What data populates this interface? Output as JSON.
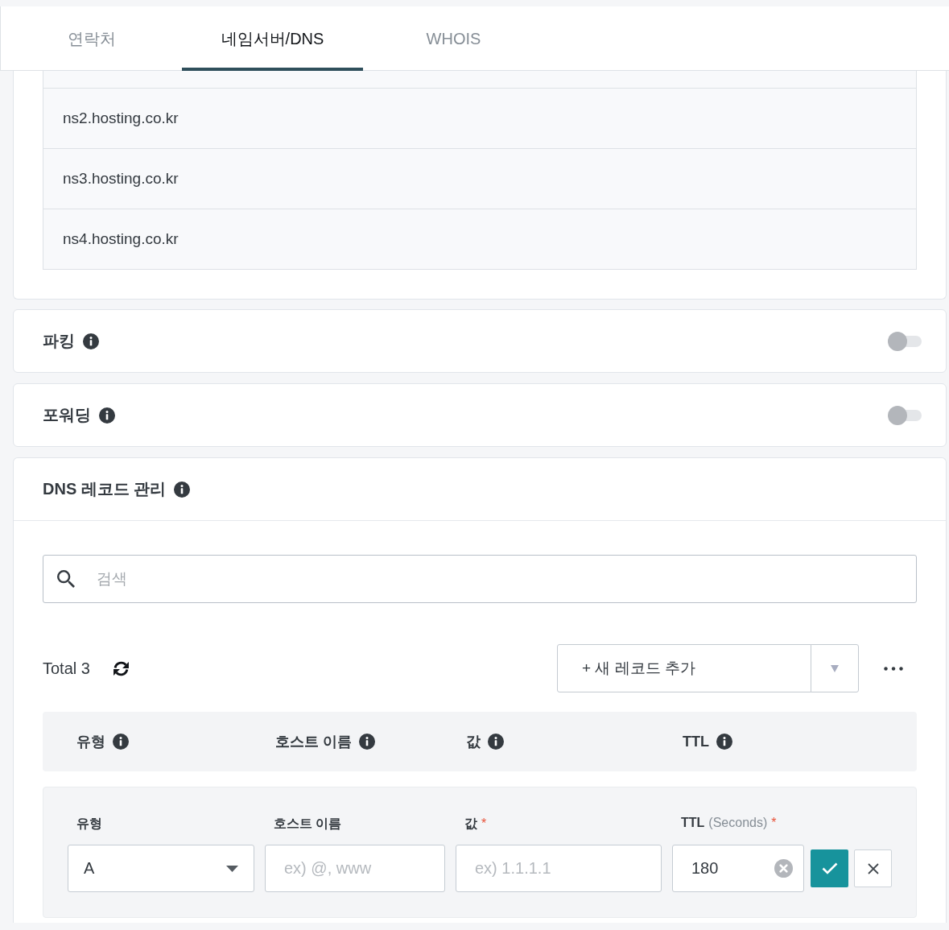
{
  "tabs": [
    {
      "label": "연락처",
      "selected": false
    },
    {
      "label": "네임서버/DNS",
      "selected": true
    },
    {
      "label": "WHOIS",
      "selected": false
    }
  ],
  "nameservers": {
    "rows": [
      "ns2.hosting.co.kr",
      "ns3.hosting.co.kr",
      "ns4.hosting.co.kr"
    ]
  },
  "toggles": [
    {
      "title": "파킹",
      "on": false
    },
    {
      "title": "포워딩",
      "on": false
    }
  ],
  "dns_records": {
    "title": "DNS 레코드 관리",
    "search": {
      "placeholder": "검색"
    },
    "total": "Total 3",
    "add_button": "+ 새 레코드 추가",
    "columns": [
      "유형",
      "호스트 이름",
      "값",
      "TTL"
    ],
    "form": {
      "fields": [
        {
          "kind": "select",
          "label": "유형",
          "value": "A"
        },
        {
          "kind": "text",
          "label": "호스트 이름",
          "placeholder": "ex) @, www"
        },
        {
          "kind": "text",
          "label": "값",
          "required_mark": "*",
          "placeholder": "ex) 1.1.1.1"
        },
        {
          "kind": "number",
          "label": "TTL",
          "unit": "(Seconds)",
          "required_mark": "*",
          "value": "180",
          "clearable": true
        }
      ]
    }
  }
}
